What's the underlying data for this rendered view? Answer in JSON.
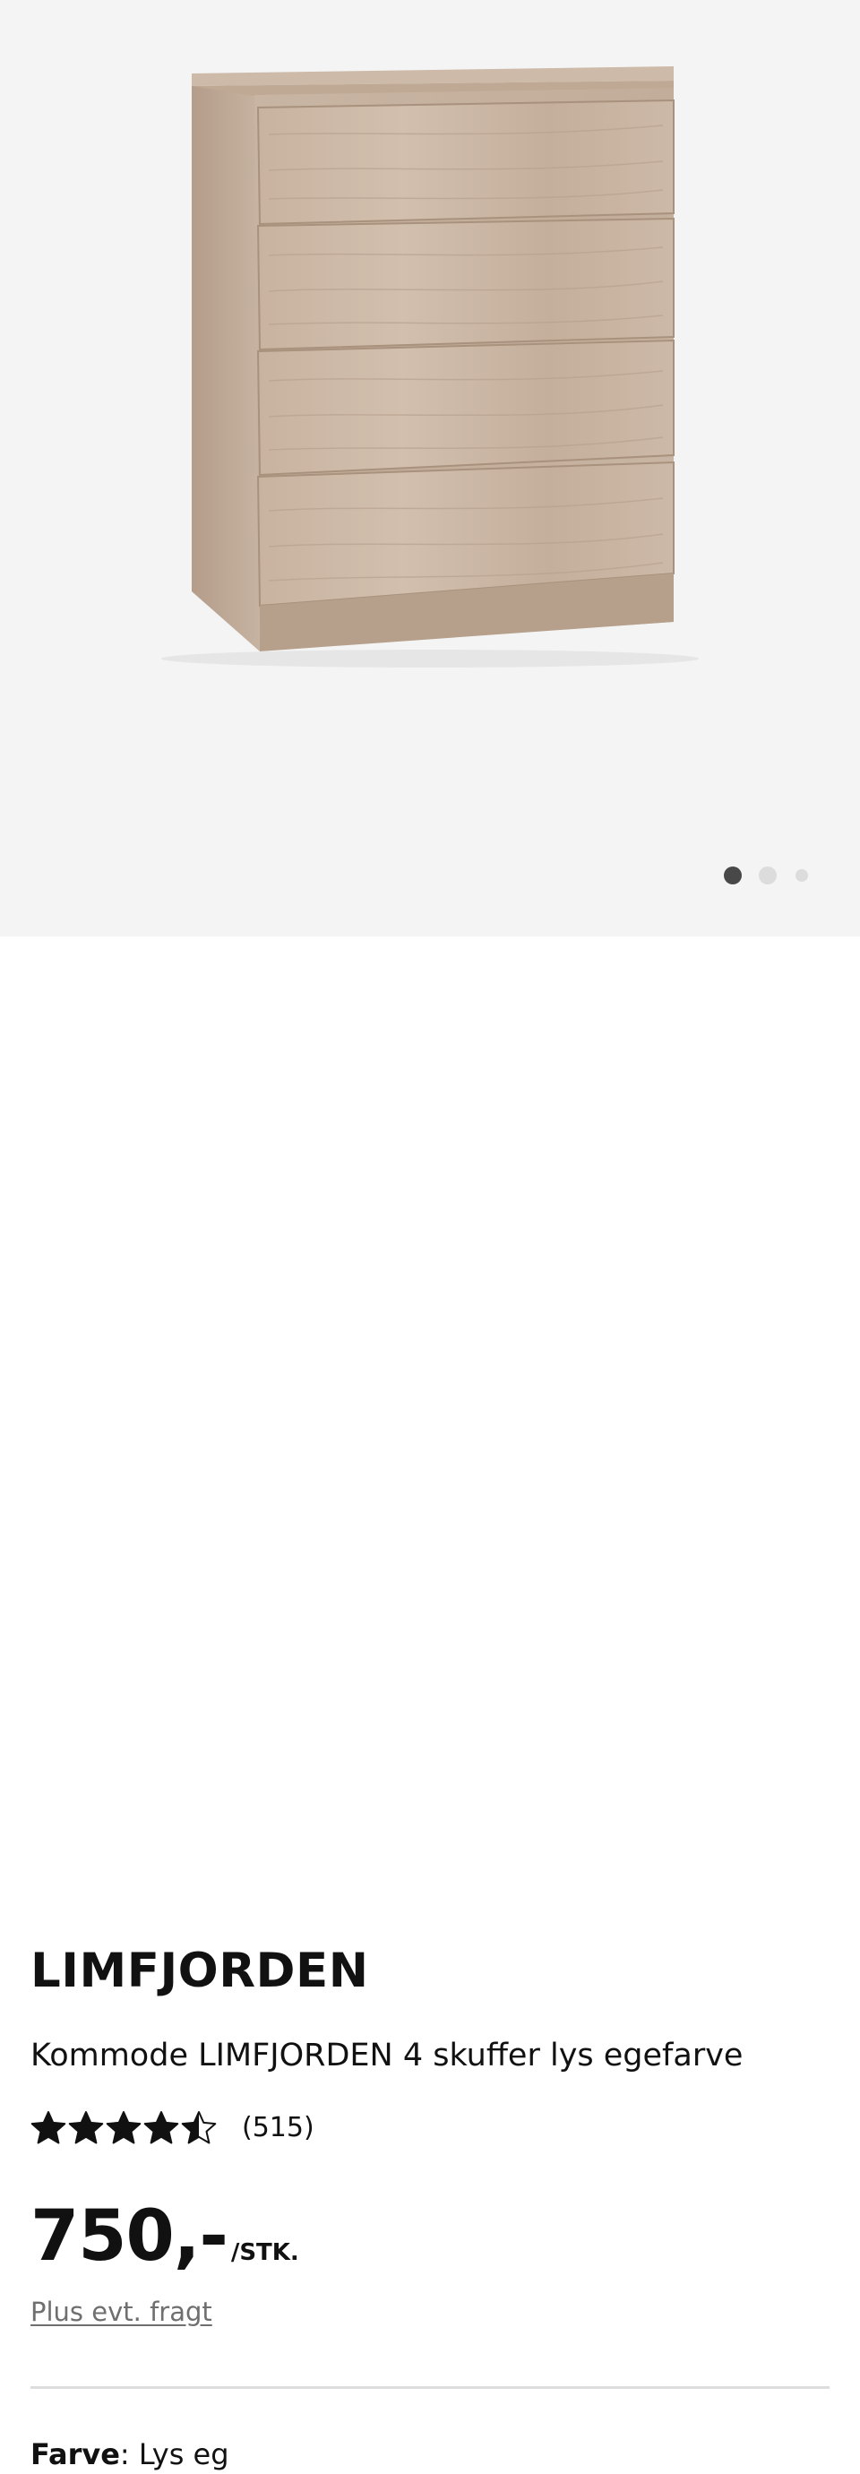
{
  "gallery": {
    "image_subject": "dresser-4-drawers-light-oak",
    "dots": [
      {
        "active": true
      },
      {
        "active": false
      },
      {
        "active": false
      }
    ],
    "colors": {
      "background": "#f4f4f4",
      "dot_active": "#484848",
      "dot_inactive": "#dcdcdc"
    }
  },
  "product": {
    "brand": "LIMFJORDEN",
    "subtitle": "Kommode LIMFJORDEN 4 skuffer lys egefarve",
    "rating": {
      "value": 4.5,
      "max": 5,
      "count_text": "(515)"
    },
    "price": "750,-",
    "price_unit": "/STK.",
    "shipping_link": "Plus evt. fragt",
    "color_label": "Farve",
    "color_separator": ": ",
    "color_value": "Lys eg"
  },
  "colors": {
    "text": "#111111",
    "muted": "#6f6f6f",
    "divider": "#dddddd"
  }
}
